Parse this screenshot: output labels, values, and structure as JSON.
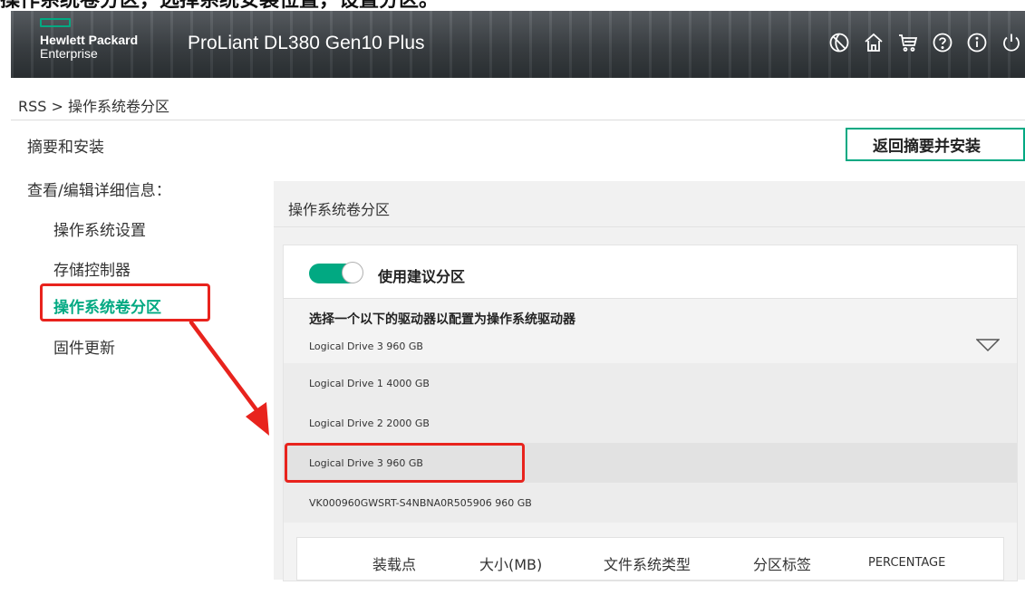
{
  "caption": "操作系统卷分区，选择系统安装位置，设置分区。",
  "header": {
    "logo_line1": "Hewlett Packard",
    "logo_line2": "Enterprise",
    "product": "ProLiant DL380 Gen10 Plus",
    "icons": [
      "globe-icon",
      "home-icon",
      "cart-icon",
      "help-icon",
      "info-icon",
      "power-icon"
    ]
  },
  "breadcrumb": "RSS > 操作系统卷分区",
  "nav": {
    "summary": "摘要和安装",
    "details_header": "查看/编辑详细信息：",
    "items": [
      "操作系统设置",
      "存储控制器",
      "操作系统卷分区",
      "固件更新"
    ],
    "active_index": 2
  },
  "return_button": "返回摘要并安装",
  "panel": {
    "title": "操作系统卷分区",
    "toggle_label": "使用建议分区",
    "toggle_on": true,
    "select_label": "选择一个以下的驱动器以配置为操作系统驱动器",
    "selected_value": "Logical Drive 3 960 GB",
    "options": [
      "Logical Drive 1 4000 GB",
      "Logical Drive 2 2000 GB",
      "Logical Drive 3 960 GB",
      "VK000960GWSRT-S4NBNA0R505906 960 GB"
    ],
    "highlighted_option_index": 2,
    "table_headers": [
      "装载点",
      "大小(MB)",
      "文件系统类型",
      "分区标签",
      "PERCENTAGE"
    ]
  },
  "colors": {
    "accent": "#01a982",
    "annotation": "#e8231d",
    "header_bg": "#3d4246"
  }
}
